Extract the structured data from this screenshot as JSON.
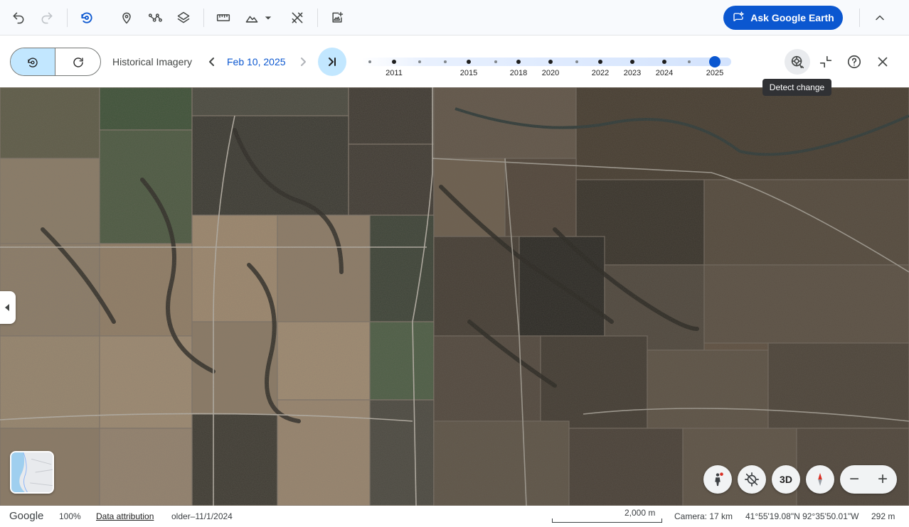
{
  "toolbar": {
    "ask_label": "Ask Google Earth",
    "tools": [
      "undo-icon",
      "redo-icon",
      "historical-imagery-icon",
      "placemark-icon",
      "path-icon",
      "layers-icon",
      "measure-icon",
      "terrain-icon",
      "tools-icon",
      "add-data-icon"
    ]
  },
  "history": {
    "label": "Historical Imagery",
    "date": "Feb 10, 2025",
    "years": [
      "2011",
      "2015",
      "2018",
      "2020",
      "2022",
      "2023",
      "2024",
      "2025"
    ],
    "selected_year": "2025",
    "tooltip": "Detect change"
  },
  "status": {
    "brand": "Google",
    "zoom": "100%",
    "attribution": "Data attribution",
    "imagery_date": "older–11/1/2024",
    "scale": "2,000 m",
    "camera": "Camera: 17 km",
    "coords": "41°55'19.08\"N 92°35'50.01\"W",
    "elevation": "292 m"
  },
  "map_controls": {
    "three_d": "3D"
  },
  "colors": {
    "accent": "#0b57d0",
    "accent_light": "#c2e7ff"
  }
}
